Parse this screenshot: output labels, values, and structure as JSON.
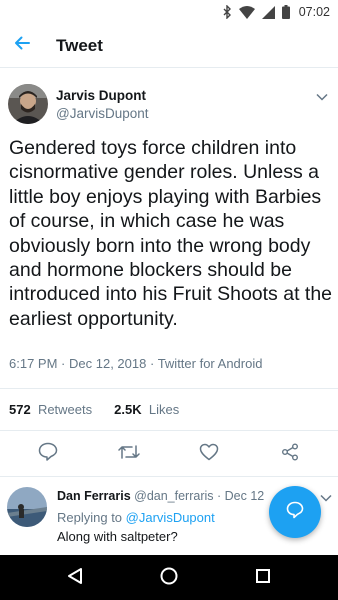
{
  "status_bar": {
    "time": "07:02"
  },
  "app_bar": {
    "title": "Tweet"
  },
  "tweet": {
    "author_name": "Jarvis Dupont",
    "author_handle": "@JarvisDupont",
    "text": "Gendered toys force children into cisnormative gender roles. Unless a little boy enjoys playing with Barbies of course, in which case he was obviously born into the wrong body and hormone blockers should be introduced into his Fruit Shoots at the earliest opportunity.",
    "time": "6:17 PM",
    "date": "Dec 12, 2018",
    "client": "Twitter for Android",
    "retweets_count": "572",
    "retweets_label": "Retweets",
    "likes_count": "2.5K",
    "likes_label": "Likes"
  },
  "reply": {
    "name": "Dan Ferraris",
    "handle": "@dan_ferraris",
    "date": "Dec 12",
    "replying_to_label": "Replying to",
    "replying_to_handle": "@JarvisDupont",
    "text": "Along with saltpeter?"
  },
  "colors": {
    "accent": "#1da1f2",
    "text_primary": "#14171a",
    "text_secondary": "#657786",
    "divider": "#e6ecf0",
    "nav_bar": "#000000"
  },
  "icons": {
    "back": "arrow-left-icon",
    "caret": "chevron-down-icon",
    "reply": "speech-bubble-icon",
    "retweet": "retweet-icon",
    "like": "heart-icon",
    "share": "share-icon",
    "compose": "compose-reply-icon"
  }
}
